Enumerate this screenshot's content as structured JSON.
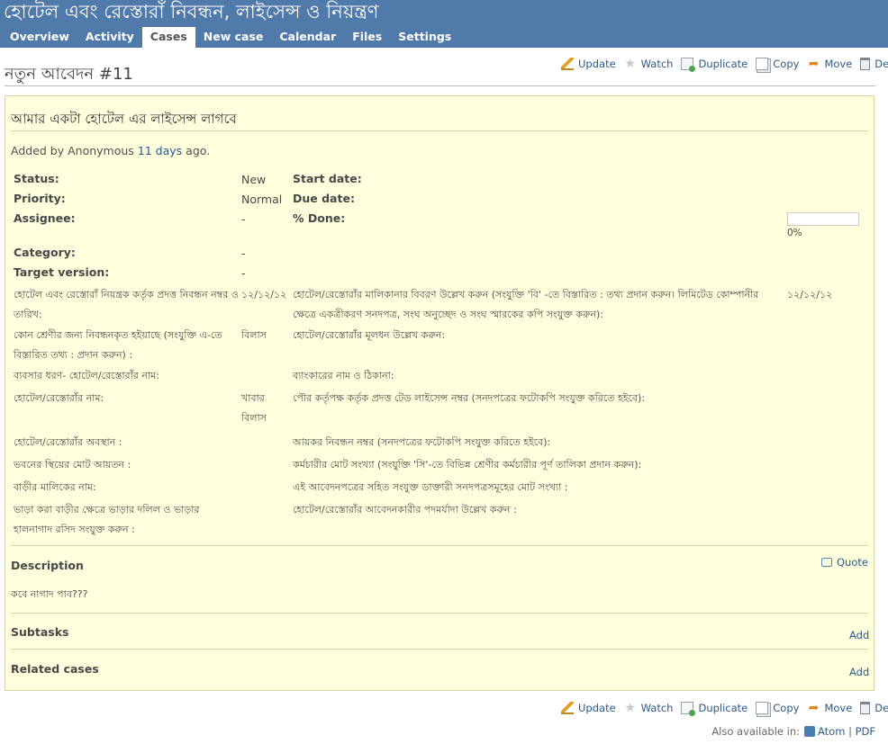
{
  "header": {
    "project_title": "হোটেল এবং রেস্তোরাঁ নিবন্ধন, লাইসেন্স ও নিয়ন্ত্রণ",
    "tabs": [
      {
        "label": "Overview"
      },
      {
        "label": "Activity"
      },
      {
        "label": "Cases",
        "selected": true
      },
      {
        "label": "New case"
      },
      {
        "label": "Calendar"
      },
      {
        "label": "Files"
      },
      {
        "label": "Settings"
      }
    ]
  },
  "actions": {
    "update": "Update",
    "watch": "Watch",
    "duplicate": "Duplicate",
    "copy": "Copy",
    "move": "Move",
    "delete": "Delete"
  },
  "issue": {
    "heading": "নতুন আবেদন #11",
    "subject": "আমার একটা হোটেল এর লাইসেন্স লাগবে",
    "author_prefix": "Added by Anonymous",
    "author_ago_link": "11 days",
    "author_suffix": "ago.",
    "attributes": {
      "status_label": "Status:",
      "status_value": "New",
      "priority_label": "Priority:",
      "priority_value": "Normal",
      "assignee_label": "Assignee:",
      "assignee_value": "-",
      "category_label": "Category:",
      "category_value": "-",
      "target_version_label": "Target version:",
      "target_version_value": "-",
      "start_date_label": "Start date:",
      "due_date_label": "Due date:",
      "done_label": "% Done:",
      "done_text": "0%",
      "done_fraction": 0
    },
    "custom_fields_left": [
      {
        "label": "হোটেল এবং রেস্তোরাঁ নিয়ন্ত্রক কর্তৃক প্রদত্ত নিবন্ধন নম্বর ও তারিখ:",
        "value": "১২/১২/১২"
      },
      {
        "label": "কোন শ্রেণীর জন্য নিবন্ধনকৃত হইয়াছে (সংযুক্তি এ-তে বিস্তারিত তথ্য : প্রদান করুন) :",
        "value": "বিলাস"
      },
      {
        "label": "ব্যবসার ধরণ- হোটেল/রেস্তোরাঁর নাম:",
        "value": ""
      },
      {
        "label": "হোটেল/রেস্তোরাঁর নাম:",
        "value": "খাবার বিলাস"
      },
      {
        "label": "হোটেল/রেস্তোরাঁর অবস্থান :",
        "value": ""
      },
      {
        "label": "ভবনের স্থিয়ের মোট আয়তন :",
        "value": ""
      },
      {
        "label": "বাড়ীর মালিকের নাম:",
        "value": ""
      },
      {
        "label": "ভাড়া করা বাড়ীর ক্ষেত্রে ভাড়ার দলিল ও ভাড়ার হালনাগাদ রসিদ সংযুক্ত করুন :",
        "value": ""
      }
    ],
    "custom_fields_right": [
      {
        "label": "হোটেল/রেস্তোরাঁর মালিকানার বিবরণ উল্লেখ করুন (সংযুক্তি 'বি' -তে বিস্তারিত : তথ্য প্রদান করুন। লিমিটেড কোম্পানীর ক্ষেত্রে একত্রীকরণ সনদপত্র, সংঘ অনুচ্ছেদ ও সংঘ স্মারকের কপি সংযুক্ত করুন):",
        "value": "১২/১২/১২"
      },
      {
        "label": "হোটেল/রেস্তোরাঁর মূলধন উল্লেখ করুন:",
        "value": ""
      },
      {
        "label": "ব্যাংকারের নাম ও ঠিকানা:",
        "value": ""
      },
      {
        "label": "পৌর কর্তৃপক্ষ কর্তৃক প্রদত্ত টেড লাইসেন্স নম্বর (সনদপত্রের ফটোকপি সংযুক্ত করিতে হইবে):",
        "value": ""
      },
      {
        "label": "আয়কর নিবন্ধন নম্বর (সনদপত্রের ফটোকপি সংযুক্ত করিতে হইবে):",
        "value": ""
      },
      {
        "label": "কর্মচারীর মোট সংখ্যা (সংযুক্তি 'সি'-তে বিভিন্ন শ্রেণীর কর্মচারীর পূর্ণ তালিকা প্রদান করুন):",
        "value": ""
      },
      {
        "label": "এই আবেদনপত্রের সহিত সংযুক্ত ডাক্তারী সনদপত্রসমূহের মোট সংখ্যা :",
        "value": ""
      },
      {
        "label": "হোটেল/রেস্তোরাঁর আবেদনকারীর পদমর্যাদা উল্লেখ করুন :",
        "value": ""
      }
    ],
    "description": {
      "title": "Description",
      "quote_label": "Quote",
      "text": "কবে নাগাদ পাব???"
    },
    "subtasks": {
      "title": "Subtasks",
      "add_label": "Add"
    },
    "related": {
      "title": "Related cases",
      "add_label": "Add"
    }
  },
  "footer": {
    "also_available": "Also available in:",
    "atom": "Atom",
    "separator": "|",
    "pdf": "PDF"
  }
}
